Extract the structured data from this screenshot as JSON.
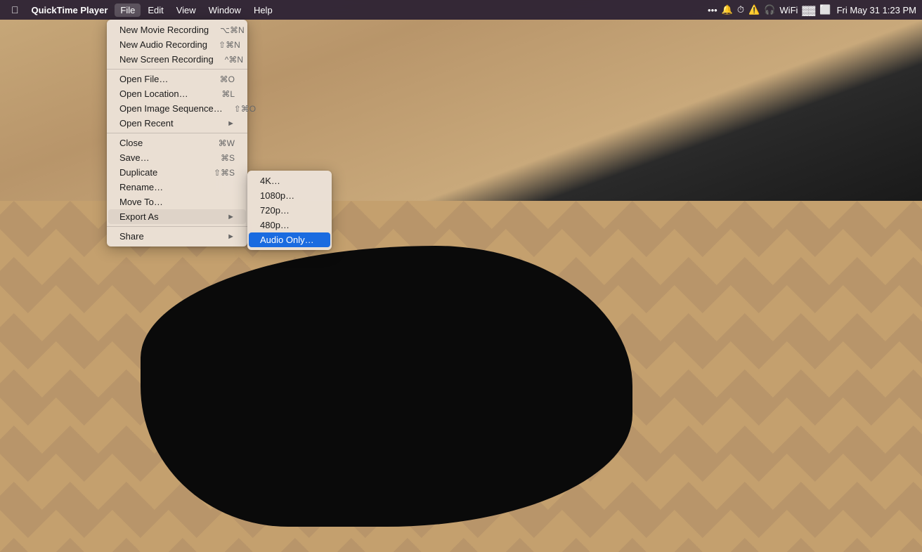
{
  "app": {
    "name": "QuickTime Player"
  },
  "menubar": {
    "apple_label": "",
    "menus": [
      {
        "label": "QuickTime Player",
        "bold": true
      },
      {
        "label": "File",
        "active": true
      },
      {
        "label": "Edit"
      },
      {
        "label": "View"
      },
      {
        "label": "Window"
      },
      {
        "label": "Help"
      }
    ],
    "datetime": "Fri May 31  1:23 PM"
  },
  "file_menu": {
    "items": [
      {
        "label": "New Movie Recording",
        "shortcut": "⌥⌘N",
        "type": "item"
      },
      {
        "label": "New Audio Recording",
        "shortcut": "⇧⌘N",
        "type": "item"
      },
      {
        "label": "New Screen Recording",
        "shortcut": "^⌘N",
        "type": "item"
      },
      {
        "type": "divider"
      },
      {
        "label": "Open File…",
        "shortcut": "⌘O",
        "type": "item"
      },
      {
        "label": "Open Location…",
        "shortcut": "⌘L",
        "type": "item"
      },
      {
        "label": "Open Image Sequence…",
        "shortcut": "⇧⌘O",
        "type": "item"
      },
      {
        "label": "Open Recent",
        "shortcut": "",
        "type": "submenu"
      },
      {
        "type": "divider"
      },
      {
        "label": "Close",
        "shortcut": "⌘W",
        "type": "item"
      },
      {
        "label": "Save…",
        "shortcut": "⌘S",
        "type": "item"
      },
      {
        "label": "Duplicate",
        "shortcut": "⇧⌘S",
        "type": "item"
      },
      {
        "label": "Rename…",
        "shortcut": "",
        "type": "item"
      },
      {
        "label": "Move To…",
        "shortcut": "",
        "type": "item"
      },
      {
        "label": "Export As",
        "shortcut": "",
        "type": "submenu",
        "open": true
      },
      {
        "type": "divider"
      },
      {
        "label": "Share",
        "shortcut": "",
        "type": "submenu"
      }
    ]
  },
  "export_submenu": {
    "items": [
      {
        "label": "4K…"
      },
      {
        "label": "1080p…"
      },
      {
        "label": "720p…"
      },
      {
        "label": "480p…"
      },
      {
        "label": "Audio Only…",
        "active": true
      }
    ]
  }
}
